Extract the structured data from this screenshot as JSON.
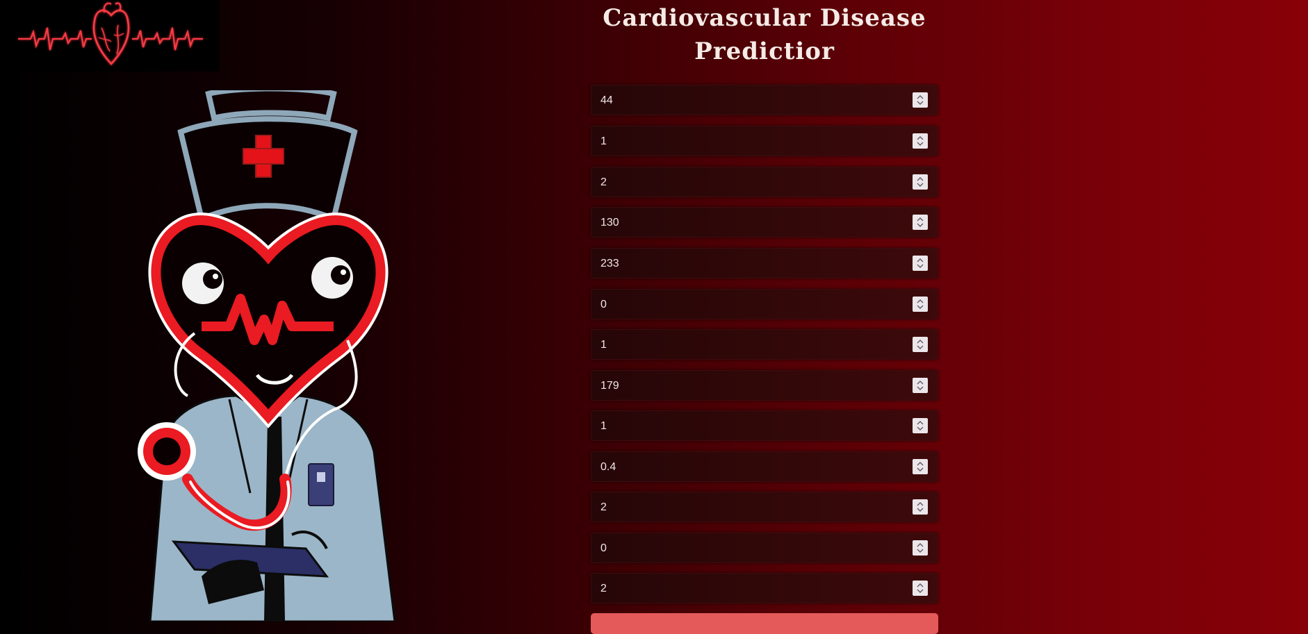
{
  "app": {
    "title_line1": "Cardiovascular Disease",
    "title_line2": "Predictior"
  },
  "icons": {
    "logo": "heart-ecg-logo-icon",
    "mascot": "heart-nurse-doctor-illustration",
    "spinner": "spinner-arrows-icon"
  },
  "colors": {
    "accent": "#e45a5a",
    "bg_dark": "#000000",
    "bg_red": "#880008"
  },
  "form": {
    "fields": [
      {
        "value": "44"
      },
      {
        "value": "1"
      },
      {
        "value": "2"
      },
      {
        "value": "130"
      },
      {
        "value": "233"
      },
      {
        "value": "0"
      },
      {
        "value": "1"
      },
      {
        "value": "179"
      },
      {
        "value": "1"
      },
      {
        "value": "0.4"
      },
      {
        "value": "2"
      },
      {
        "value": "0"
      },
      {
        "value": "2"
      }
    ]
  }
}
